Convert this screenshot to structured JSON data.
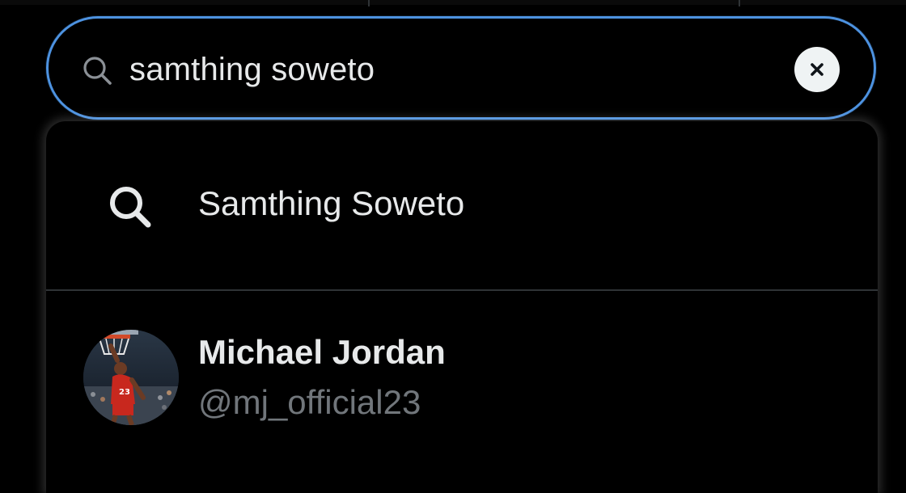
{
  "search": {
    "value": "samthing soweto",
    "icon": "search-icon",
    "clear_icon": "close-icon"
  },
  "dropdown": {
    "suggestion": {
      "icon": "search-icon",
      "text": "Samthing Soweto"
    },
    "user": {
      "name": "Michael Jordan",
      "handle": "@mj_official23",
      "avatar": "avatar-image"
    }
  },
  "colors": {
    "focus_border": "#4d92e0",
    "background": "#000000",
    "primary_text": "#e7e9ea",
    "secondary_text": "#71767b",
    "divider": "#2f3336"
  }
}
